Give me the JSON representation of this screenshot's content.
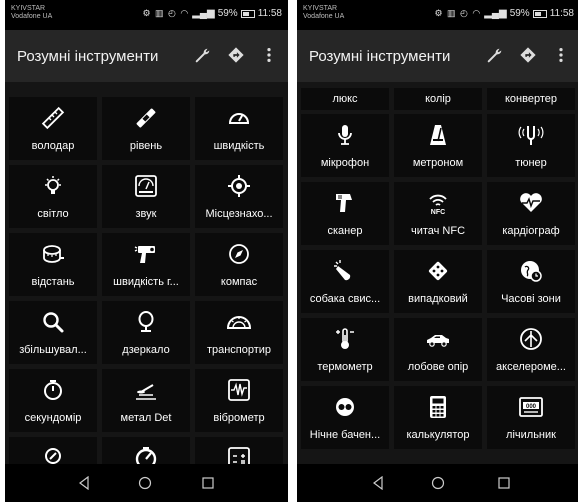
{
  "status": {
    "carrier_line1": "KYIVSTAR",
    "carrier_line2": "Vodafone UA",
    "icons": "⚙ ▥ ◴ ◠",
    "battery": "59%",
    "time": "11:58"
  },
  "app": {
    "title": "Розумні інструменти"
  },
  "left": {
    "tools": [
      {
        "label": "володар",
        "icon": "ruler-icon"
      },
      {
        "label": "рівень",
        "icon": "level-icon"
      },
      {
        "label": "швидкість",
        "icon": "speedometer-icon"
      },
      {
        "label": "світло",
        "icon": "lightbulb-icon"
      },
      {
        "label": "звук",
        "icon": "sound-meter-icon"
      },
      {
        "label": "Місцезнахо...",
        "icon": "location-target-icon"
      },
      {
        "label": "відстань",
        "icon": "tape-measure-icon"
      },
      {
        "label": "швидкість г...",
        "icon": "speed-gun-icon"
      },
      {
        "label": "компас",
        "icon": "compass-icon"
      },
      {
        "label": "збільшувал...",
        "icon": "magnifier-icon"
      },
      {
        "label": "дзеркало",
        "icon": "mirror-icon"
      },
      {
        "label": "транспортир",
        "icon": "protractor-icon"
      },
      {
        "label": "секундомір",
        "icon": "stopwatch-icon"
      },
      {
        "label": "метал Det",
        "icon": "metal-detector-icon"
      },
      {
        "label": "віброметр",
        "icon": "vibrometer-icon"
      },
      {
        "label": "",
        "icon": "gps-pin-icon"
      },
      {
        "label": "",
        "icon": "gauge-icon"
      },
      {
        "label": "",
        "icon": "calculator-box-icon"
      }
    ]
  },
  "right": {
    "tabs": [
      "люкс",
      "колір",
      "конвертер"
    ],
    "tools": [
      {
        "label": "мікрофон",
        "icon": "microphone-icon"
      },
      {
        "label": "метроном",
        "icon": "metronome-icon"
      },
      {
        "label": "тюнер",
        "icon": "tuner-icon"
      },
      {
        "label": "сканер",
        "icon": "scanner-icon"
      },
      {
        "label": "читач NFC",
        "icon": "nfc-icon",
        "icon_text": "NFC"
      },
      {
        "label": "кардіограф",
        "icon": "heart-pulse-icon"
      },
      {
        "label": "собака свис...",
        "icon": "dog-whistle-icon"
      },
      {
        "label": "випадковий",
        "icon": "random-dice-icon"
      },
      {
        "label": "Часові зони",
        "icon": "time-zones-icon"
      },
      {
        "label": "термометр",
        "icon": "thermometer-icon"
      },
      {
        "label": "лобове опір",
        "icon": "car-drag-icon"
      },
      {
        "label": "акселероме...",
        "icon": "accelerometer-icon"
      },
      {
        "label": "Нічне бачен...",
        "icon": "night-vision-icon"
      },
      {
        "label": "калькулятор",
        "icon": "calculator-icon"
      },
      {
        "label": "лічильник",
        "icon": "counter-icon",
        "icon_text": "000"
      }
    ]
  }
}
